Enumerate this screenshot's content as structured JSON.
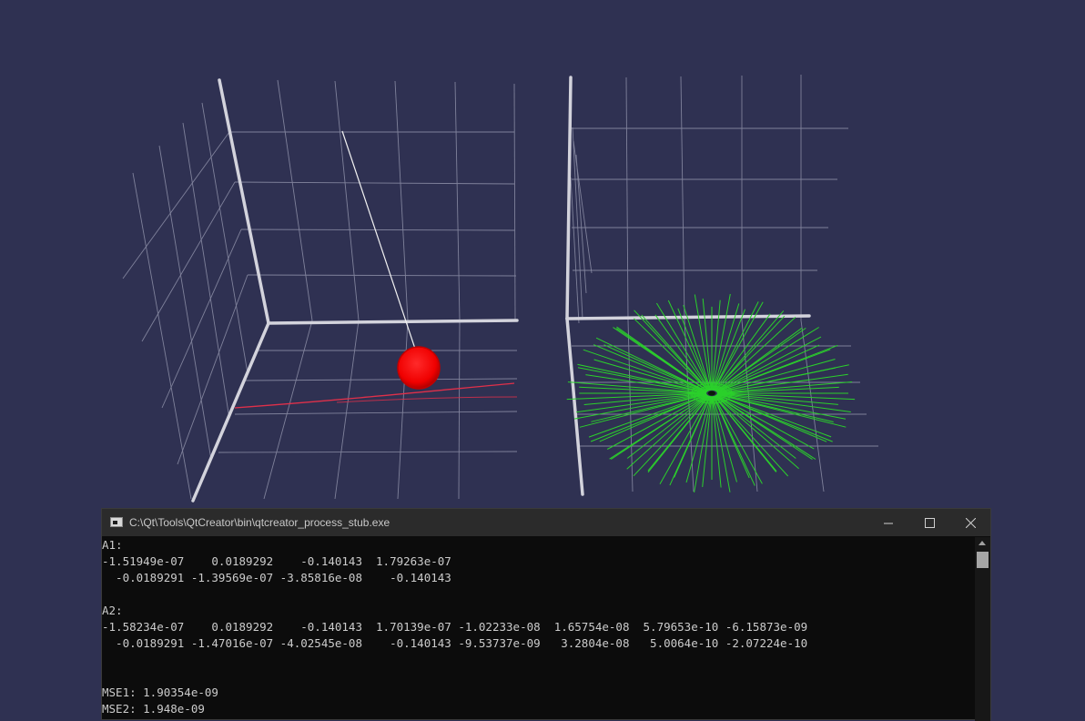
{
  "window": {
    "title": "C:\\Qt\\Tools\\QtCreator\\bin\\qtcreator_process_stub.exe",
    "minimize_icon": "minimize-icon",
    "maximize_icon": "maximize-icon",
    "close_icon": "close-icon"
  },
  "console": {
    "lines": [
      "A1:",
      "-1.51949e-07    0.0189292    -0.140143  1.79263e-07",
      "  -0.0189291 -1.39569e-07 -3.85816e-08    -0.140143",
      "",
      "A2:",
      "-1.58234e-07    0.0189292    -0.140143  1.70139e-07 -1.02233e-08  1.65754e-08  5.79653e-10 -6.15873e-09",
      "  -0.0189291 -1.47016e-07 -4.02545e-08    -0.140143 -9.53737e-09   3.2804e-08   5.0064e-10 -2.07224e-10",
      "",
      "",
      "MSE1: 1.90354e-09",
      "MSE2: 1.948e-09"
    ]
  },
  "scene": {
    "background_color": "#2f3152",
    "axis_color": "#d3d3dc",
    "grid_color": "#8e90a8",
    "pendulum_bob_color": "#ff0000",
    "trajectory_color": "#e0304a",
    "vector_field_color": "#2bd02b"
  }
}
